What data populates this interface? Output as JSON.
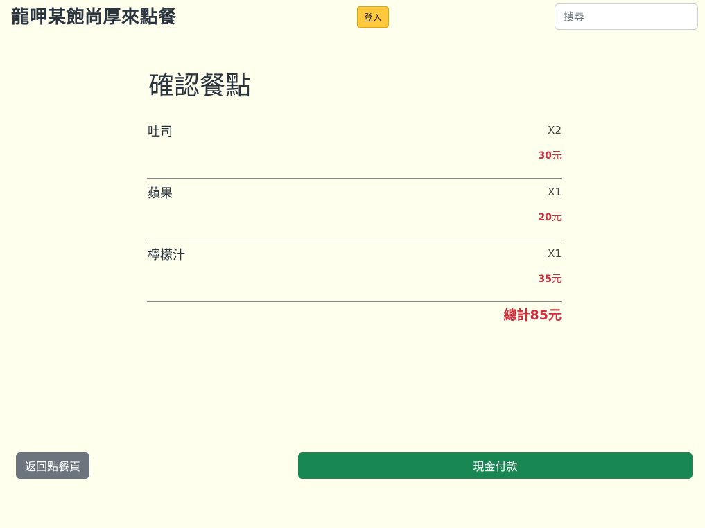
{
  "header": {
    "brand": "龍呷某飽尚厚來點餐",
    "login_label": "登入",
    "search_placeholder": "搜尋",
    "search_value": ""
  },
  "main": {
    "title": "確認餐點",
    "items": [
      {
        "name": "吐司",
        "qty": "X2",
        "price": "30",
        "unit": "元"
      },
      {
        "name": "蘋果",
        "qty": "X1",
        "price": "20",
        "unit": "元"
      },
      {
        "name": "檸檬汁",
        "qty": "X1",
        "price": "35",
        "unit": "元"
      }
    ],
    "total_label": "總計",
    "total_value": "85",
    "total_unit": "元"
  },
  "footer": {
    "back_label": "返回點餐頁",
    "pay_label": "現金付款"
  },
  "colors": {
    "background": "#ffffee",
    "accent_red": "#cf2e3d",
    "pay_green": "#198754",
    "back_gray": "#6c757d",
    "login_yellow": "#ffc83d"
  }
}
